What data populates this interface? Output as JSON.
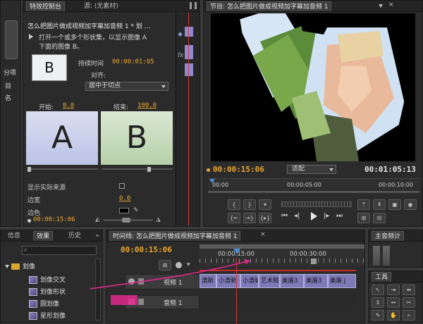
{
  "left_strip": {
    "label1": "分项",
    "label2": "目",
    "label3": "名"
  },
  "effect_controls": {
    "tab_active": "特效控制台",
    "tab_source": "源: (无素材)",
    "title": "怎么把图片做成视频加字幕加音频 1 * 划 …",
    "description_line1": "打开一个或多个形状集，以显示图像 A",
    "description_line2": "下面的图像 B。",
    "duration_label": "持续时间",
    "duration": "00:00:01:05",
    "align_label": "对齐:",
    "align_value": "居中于切点",
    "start_label": "开始:",
    "start_value": "0.0",
    "end_label": "结束:",
    "end_value": "100.0",
    "preview_a": "A",
    "preview_b": "B",
    "preview_thumb": "B",
    "show_actual_source": "显示实际来源",
    "border_width_label": "边宽",
    "border_width_value": "0.0",
    "border_color_label": "边色",
    "timecode": "00:00:15:06",
    "strip_fx": "fx",
    "strip_marker": "◈"
  },
  "program_monitor": {
    "title": "节目: 怎么把图片做成视频加字幕加音频 1",
    "current_time": "00:00:15:06",
    "fit": "适配",
    "duration": "00:01:05:13",
    "ruler_start": "00:00",
    "ruler_mid": "00:00:05:00",
    "ruler_end": "00:00:10:00"
  },
  "project_panel": {
    "tabs": [
      "信息",
      "效果",
      "历史"
    ],
    "items": [
      {
        "label": "划像",
        "type": "folder"
      },
      {
        "label": "划像交叉",
        "type": "effect"
      },
      {
        "label": "划像形状",
        "type": "effect"
      },
      {
        "label": "圆划像",
        "type": "effect"
      },
      {
        "label": "星形划像",
        "type": "effect"
      }
    ]
  },
  "timeline": {
    "title": "时间线: 怎么把图片做成视频加字幕加音频 1",
    "timecode": "00:00:15:06",
    "ruler1": "00:00:15:00",
    "ruler2": "00:00:30:00",
    "video_track": "视频 1",
    "audio_track": "音频 1",
    "clips": [
      "清新",
      "小清新",
      "小清新",
      "艺术照",
      "美眉3",
      "美眉3",
      "美眉 J"
    ]
  },
  "audio_meter": {
    "title": "主音频计"
  },
  "tools": {
    "title": "工具"
  },
  "colors": {
    "accent": "#e8a631",
    "playhead": "#d53b3b",
    "clip": "#7e7ab8",
    "arrow": "#e0288c"
  }
}
